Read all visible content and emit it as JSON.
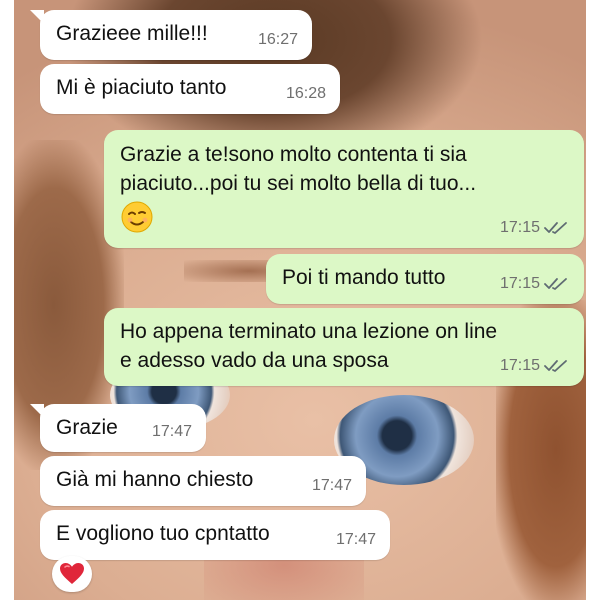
{
  "conversation": {
    "messages": [
      {
        "direction": "incoming",
        "text": "Grazieee mille!!!",
        "time": "16:27"
      },
      {
        "direction": "incoming",
        "text": "Mi è piaciuto tanto",
        "time": "16:28"
      },
      {
        "direction": "outgoing",
        "text": "Grazie a te!sono molto contenta ti sia\npiaciuto...poi tu sei molto bella di tuo...",
        "emoji": "winking-face",
        "time": "17:15",
        "status": "read"
      },
      {
        "direction": "outgoing",
        "text": "Poi ti mando tutto",
        "time": "17:15",
        "status": "read"
      },
      {
        "direction": "outgoing",
        "text": "Ho appena terminato una lezione on line\ne adesso vado da una sposa",
        "time": "17:15",
        "status": "read"
      },
      {
        "direction": "incoming",
        "text": "Grazie",
        "time": "17:47"
      },
      {
        "direction": "incoming",
        "text": "Già mi hanno chiesto",
        "time": "17:47"
      },
      {
        "direction": "incoming",
        "text": "E vogliono tuo cpntatto",
        "time": "17:47",
        "reaction": "red-heart"
      }
    ]
  },
  "colors": {
    "incoming_bubble": "#ffffff",
    "outgoing_bubble": "#dcf8c6",
    "timestamp": "#6f6f6f",
    "read_ticks": "#5f6b73",
    "heart": "#e0263a"
  },
  "icons": {
    "status": "double-check-icon",
    "emoji": "winking-face-emoji",
    "reaction": "heart-icon"
  }
}
